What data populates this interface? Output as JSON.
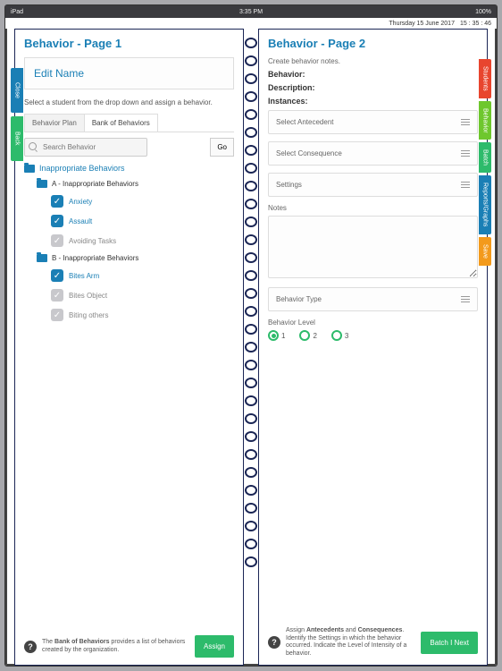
{
  "status": {
    "left": "iPad",
    "center": "3:35 PM",
    "right": "100%"
  },
  "date": {
    "day": "Thursday 15 June 2017",
    "time": "15 : 35 : 46"
  },
  "leftTabs": [
    {
      "label": "Close",
      "color": "#1a7fb5"
    },
    {
      "label": "Back",
      "color": "#2dbb6b"
    }
  ],
  "rightTabs": [
    {
      "label": "Students",
      "color": "#e8452e"
    },
    {
      "label": "Behavior",
      "color": "#6ec72d"
    },
    {
      "label": "Batch",
      "color": "#2dbb6b"
    },
    {
      "label": "Reports/Graphs",
      "color": "#1a7fb5"
    },
    {
      "label": "Save",
      "color": "#f39a1c"
    }
  ],
  "page1": {
    "title": "Behavior - Page 1",
    "editName": "Edit Name",
    "hint": "Select a student from the drop down and assign a behavior.",
    "tabs": {
      "a": "Behavior Plan",
      "b": "Bank of Behaviors"
    },
    "searchPlaceholder": "Search Behavior",
    "go": "Go",
    "rootFolder": "Inappropriate Behaviors",
    "groupA": {
      "title": "A - Inappropriate Behaviors",
      "items": [
        {
          "label": "Anxiety",
          "on": true
        },
        {
          "label": "Assault",
          "on": true
        },
        {
          "label": "Avoiding Tasks",
          "on": false
        }
      ]
    },
    "groupB": {
      "title": "B - Inappropriate Behaviors",
      "items": [
        {
          "label": "Bites Arm",
          "on": true
        },
        {
          "label": "Bites Object",
          "on": false
        },
        {
          "label": "Biting others",
          "on": false
        }
      ]
    },
    "footHelp": "The <b>Bank of Behaviors</b> provides a list of behaviors created by the organization.",
    "assign": "Assign"
  },
  "page2": {
    "title": "Behavior - Page 2",
    "intro": "Create behavior notes.",
    "behaviorLbl": "Behavior:",
    "descLbl": "Description:",
    "instLbl": "Instances:",
    "selects": {
      "a": "Select Antecedent",
      "b": "Select Consequence",
      "c": "Settings"
    },
    "notes": "Notes",
    "behaviorType": "Behavior Type",
    "levelLbl": "Behavior Level",
    "levels": [
      "1",
      "2",
      "3"
    ],
    "footHelp": "Assign <b>Antecedents</b> and <b>Consequences</b>. Identify the Settings in which the behavior occurred. Indicate the Level of Intensity of a behavior.",
    "next": "Batch I Next"
  }
}
